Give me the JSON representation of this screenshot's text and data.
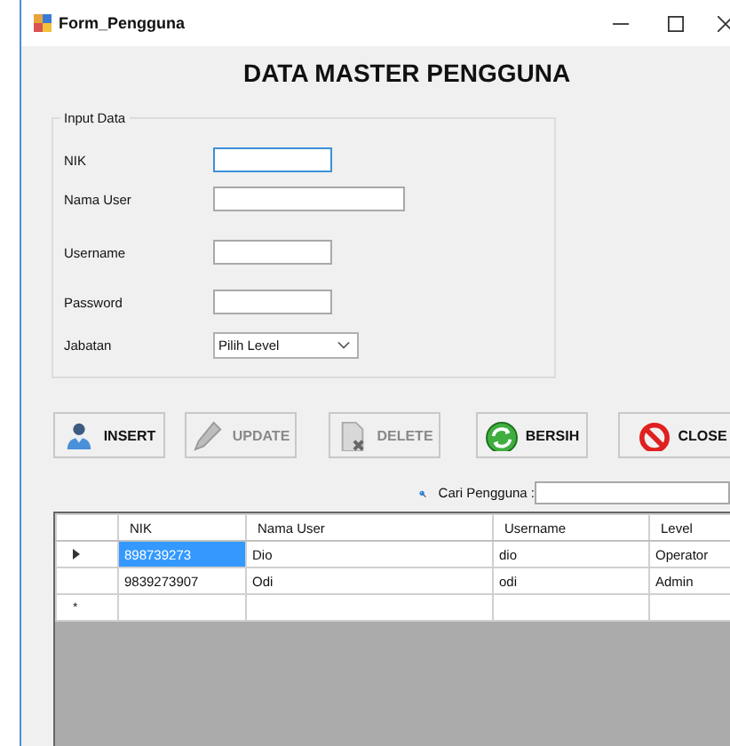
{
  "window": {
    "title": "Form_Pengguna"
  },
  "heading": "DATA MASTER PENGGUNA",
  "input_group": {
    "title": "Input Data",
    "fields": [
      {
        "label": "NIK",
        "kind": "text",
        "focused": true
      },
      {
        "label": "Nama User",
        "kind": "text",
        "focused": false
      },
      {
        "label": "Username",
        "kind": "text",
        "focused": false
      },
      {
        "label": "Password",
        "kind": "text",
        "focused": false
      },
      {
        "label": "Jabatan",
        "kind": "combo",
        "value": "Pilih Level",
        "focused": false
      }
    ]
  },
  "buttons": [
    {
      "label": "INSERT",
      "kind": "user",
      "disabled": false
    },
    {
      "label": "UPDATE",
      "kind": "pencil",
      "disabled": true
    },
    {
      "label": "DELETE",
      "kind": "document",
      "disabled": true
    },
    {
      "label": "BERSIH",
      "kind": "refresh",
      "disabled": false
    },
    {
      "label": "CLOSE",
      "kind": "forbidden",
      "disabled": false
    }
  ],
  "search": {
    "label": "Cari Pengguna :"
  },
  "table": {
    "columns": [
      "NIK",
      "Nama User",
      "Username",
      "Level"
    ],
    "rows": [
      {
        "current": true,
        "cells": [
          {
            "text": "898739273",
            "selected": true
          },
          {
            "text": "Dio",
            "selected": false
          },
          {
            "text": "dio",
            "selected": false
          },
          {
            "text": "Operator",
            "selected": false
          }
        ]
      },
      {
        "current": false,
        "cells": [
          {
            "text": "9839273907",
            "selected": false
          },
          {
            "text": "Odi",
            "selected": false
          },
          {
            "text": "odi",
            "selected": false
          },
          {
            "text": "Admin",
            "selected": false
          }
        ]
      }
    ],
    "new_row_marker": "*"
  }
}
